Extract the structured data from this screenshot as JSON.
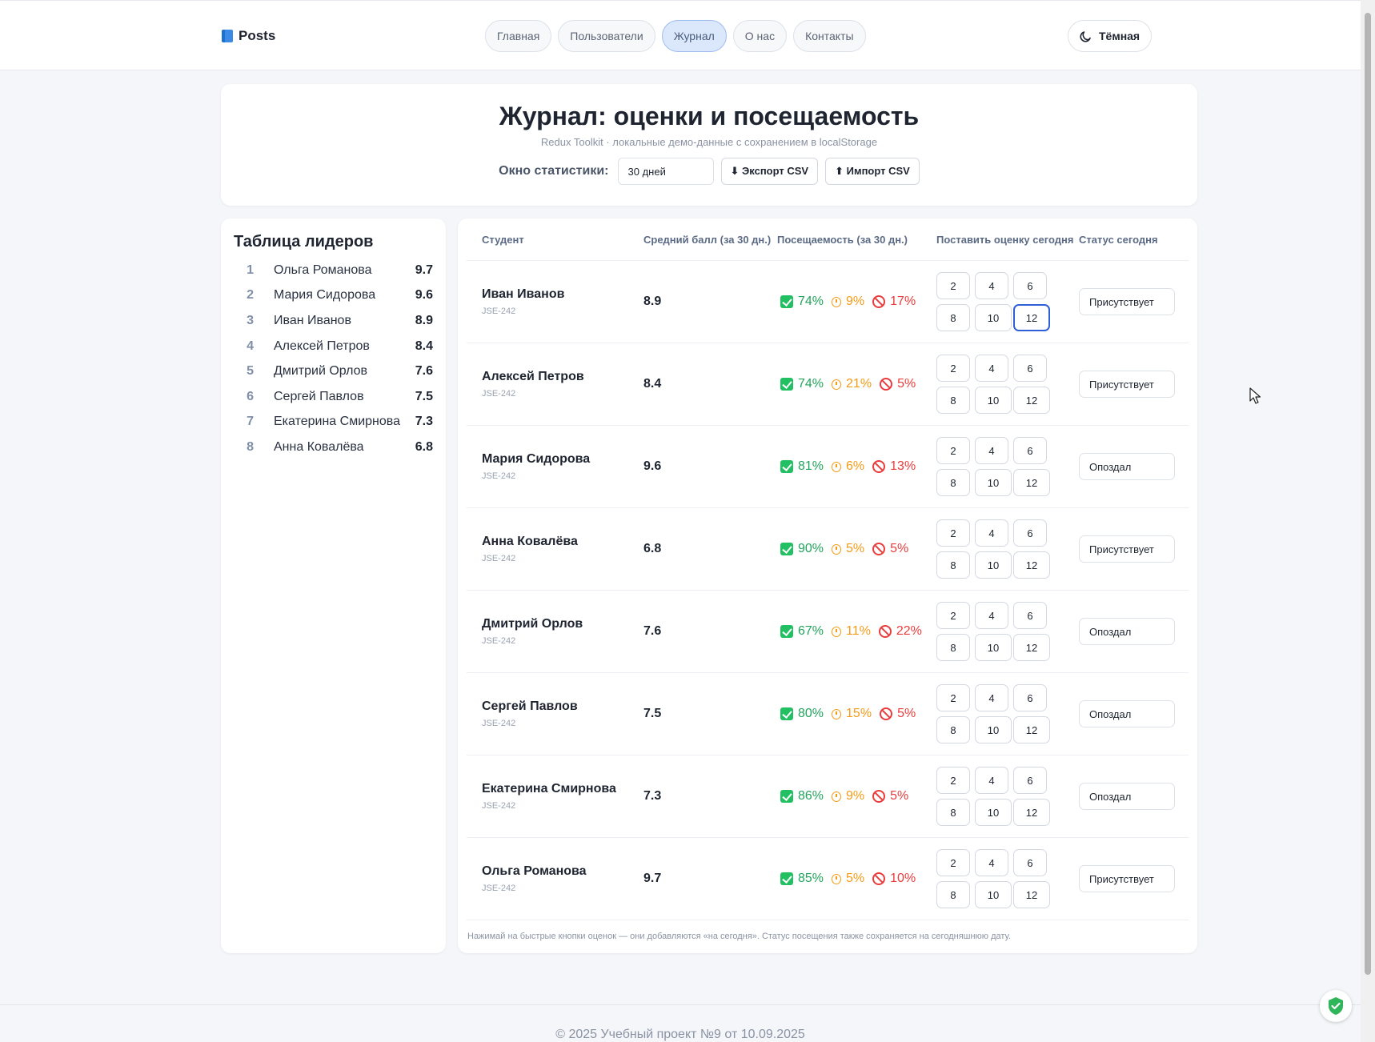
{
  "brand": {
    "name": "Posts",
    "icon": "book-icon"
  },
  "nav": {
    "tabs": [
      {
        "label": "Главная",
        "active": false
      },
      {
        "label": "Пользователи",
        "active": false
      },
      {
        "label": "Журнал",
        "active": true
      },
      {
        "label": "О нас",
        "active": false
      },
      {
        "label": "Контакты",
        "active": false
      }
    ],
    "theme_label": "Тёмная"
  },
  "hero": {
    "title": "Журнал: оценки и посещаемость",
    "subtitle": "Redux Toolkit · локальные демо-данные с сохранением в localStorage",
    "window_label": "Окно статистики:",
    "window_value": "30 дней",
    "export_label": "⬇ Экспорт CSV",
    "import_label": "⬆ Импорт CSV"
  },
  "leaderboard": {
    "title": "Таблица лидеров",
    "items": [
      {
        "rank": "1",
        "name": "Ольга Романова",
        "score": "9.7"
      },
      {
        "rank": "2",
        "name": "Мария Сидорова",
        "score": "9.6"
      },
      {
        "rank": "3",
        "name": "Иван Иванов",
        "score": "8.9"
      },
      {
        "rank": "4",
        "name": "Алексей Петров",
        "score": "8.4"
      },
      {
        "rank": "5",
        "name": "Дмитрий Орлов",
        "score": "7.6"
      },
      {
        "rank": "6",
        "name": "Сергей Павлов",
        "score": "7.5"
      },
      {
        "rank": "7",
        "name": "Екатерина Смирнова",
        "score": "7.3"
      },
      {
        "rank": "8",
        "name": "Анна Ковалёва",
        "score": "6.8"
      }
    ]
  },
  "journal": {
    "headers": {
      "student": "Студент",
      "avg": "Средний балл (за 30 дн.)",
      "attendance": "Посещаемость (за 30 дн.)",
      "grade": "Поставить оценку сегодня",
      "status": "Статус сегодня"
    },
    "grade_buttons": [
      "2",
      "4",
      "6",
      "8",
      "10",
      "12"
    ],
    "rows": [
      {
        "name": "Иван Иванов",
        "group": "JSE-242",
        "avg": "8.9",
        "present": "74%",
        "late": "9%",
        "absent": "17%",
        "status": "Присутствует",
        "selected_grade": "12"
      },
      {
        "name": "Алексей Петров",
        "group": "JSE-242",
        "avg": "8.4",
        "present": "74%",
        "late": "21%",
        "absent": "5%",
        "status": "Присутствует",
        "selected_grade": ""
      },
      {
        "name": "Мария Сидорова",
        "group": "JSE-242",
        "avg": "9.6",
        "present": "81%",
        "late": "6%",
        "absent": "13%",
        "status": "Опоздал",
        "selected_grade": ""
      },
      {
        "name": "Анна Ковалёва",
        "group": "JSE-242",
        "avg": "6.8",
        "present": "90%",
        "late": "5%",
        "absent": "5%",
        "status": "Присутствует",
        "selected_grade": ""
      },
      {
        "name": "Дмитрий Орлов",
        "group": "JSE-242",
        "avg": "7.6",
        "present": "67%",
        "late": "11%",
        "absent": "22%",
        "status": "Опоздал",
        "selected_grade": ""
      },
      {
        "name": "Сергей Павлов",
        "group": "JSE-242",
        "avg": "7.5",
        "present": "80%",
        "late": "15%",
        "absent": "5%",
        "status": "Опоздал",
        "selected_grade": ""
      },
      {
        "name": "Екатерина Смирнова",
        "group": "JSE-242",
        "avg": "7.3",
        "present": "86%",
        "late": "9%",
        "absent": "5%",
        "status": "Опоздал",
        "selected_grade": ""
      },
      {
        "name": "Ольга Романова",
        "group": "JSE-242",
        "avg": "9.7",
        "present": "85%",
        "late": "5%",
        "absent": "10%",
        "status": "Присутствует",
        "selected_grade": ""
      }
    ],
    "hint": "Нажимай на быстрые кнопки оценок — они добавляются «на сегодня». Статус посещения также сохраняется на сегодняшнюю дату."
  },
  "footer": {
    "text": "© 2025 Учебный проект №9 от 10.09.2025"
  },
  "colors": {
    "accent": "#2f5fd6",
    "present": "#22a45d",
    "late": "#f59b16",
    "absent": "#ea3c3c"
  }
}
